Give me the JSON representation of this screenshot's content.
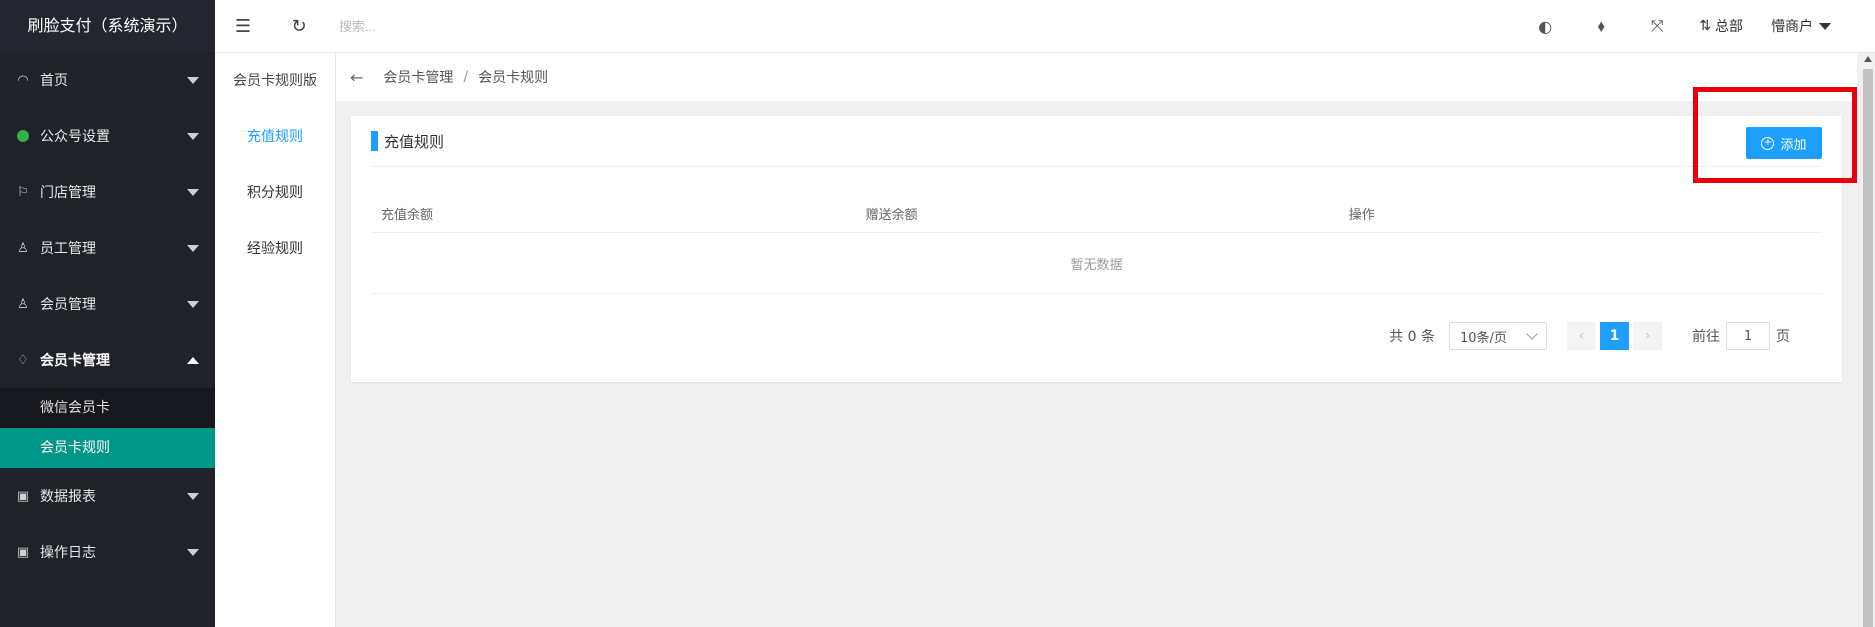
{
  "sidebar": {
    "brand": "刷脸支付（系统演示）",
    "items": [
      {
        "label": "首页",
        "icon": "speedometer-icon"
      },
      {
        "label": "公众号设置",
        "icon": "wechat-icon"
      },
      {
        "label": "门店管理",
        "icon": "flag-icon"
      },
      {
        "label": "员工管理",
        "icon": "user-icon"
      },
      {
        "label": "会员管理",
        "icon": "user-icon"
      },
      {
        "label": "会员卡管理",
        "icon": "diamond-icon"
      },
      {
        "label": "数据报表",
        "icon": "clipboard-icon"
      },
      {
        "label": "操作日志",
        "icon": "clipboard-icon"
      }
    ],
    "sub_items": [
      {
        "label": "微信会员卡"
      },
      {
        "label": "会员卡规则"
      }
    ]
  },
  "header": {
    "search_placeholder": "搜索...",
    "hq_label": "总部",
    "user_label": "懵商户"
  },
  "column": {
    "title": "会员卡规则版",
    "items": [
      {
        "label": "充值规则"
      },
      {
        "label": "积分规则"
      },
      {
        "label": "经验规则"
      }
    ]
  },
  "breadcrumb": {
    "back": "←",
    "parent": "会员卡管理",
    "separator": "/",
    "current": "会员卡规则"
  },
  "card": {
    "title": "充值规则",
    "add_button": "添加",
    "columns": [
      "充值余额",
      "赠送余额",
      "操作"
    ],
    "empty_text": "暂无数据"
  },
  "pagination": {
    "total": "共 0 条",
    "page_size": "10条/页",
    "prev": "‹",
    "current_page": "1",
    "next": "›",
    "goto_label": "前往",
    "goto_value": "1",
    "page_suffix": "页"
  },
  "colors": {
    "sidebar_bg": "#20222a",
    "accent": "#1e9fff",
    "selected": "#009688",
    "highlight": "#e8000b"
  }
}
